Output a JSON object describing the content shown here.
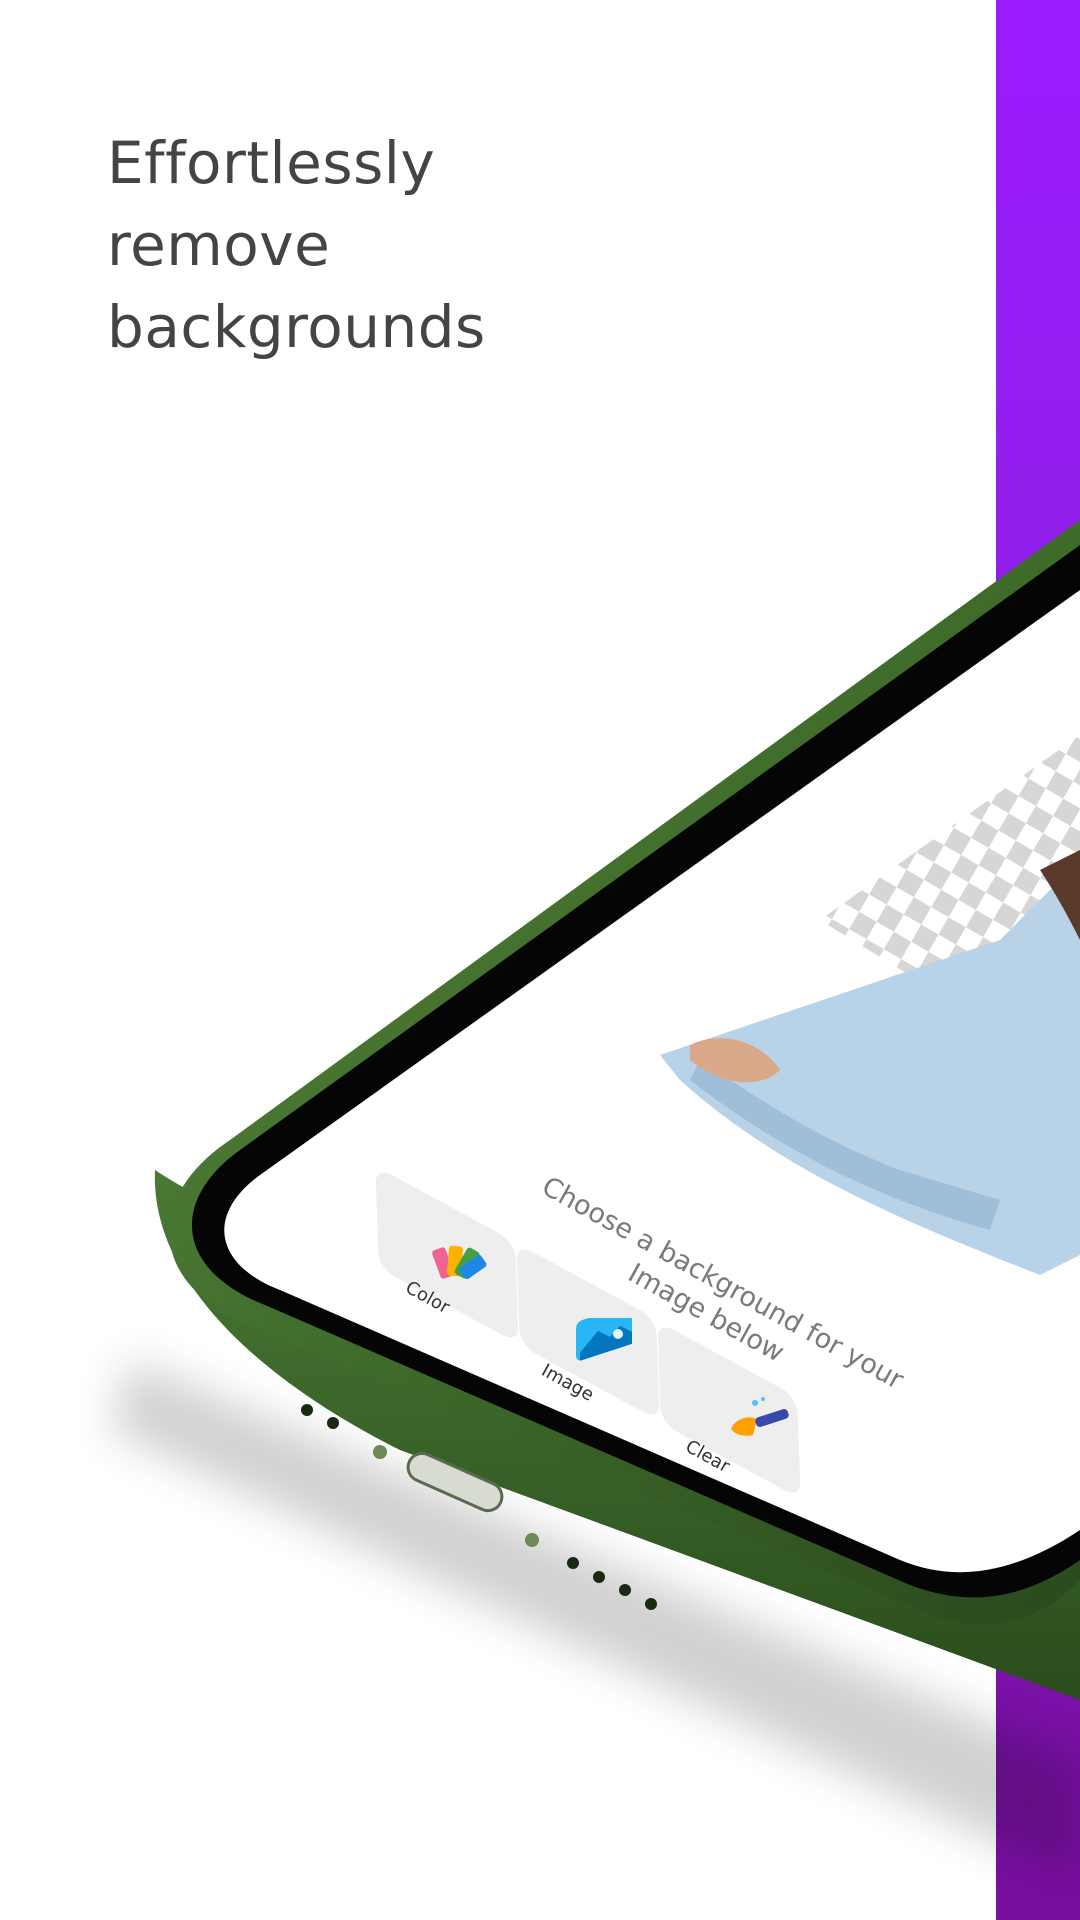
{
  "headline": {
    "line1": "Effortlessly",
    "line2": "remove",
    "line3": "backgrounds"
  },
  "phone_screen": {
    "prompt": "Choose a background for your Image below",
    "options": [
      {
        "label": "Color",
        "icon": "color-palette-icon"
      },
      {
        "label": "Image",
        "icon": "image-icon"
      },
      {
        "label": "Clear",
        "icon": "clear-brush-icon"
      }
    ]
  },
  "colors": {
    "accent_purple": "#9a1cff",
    "phone_frame_green": "#3f6a2c",
    "headline_text": "#444444"
  }
}
